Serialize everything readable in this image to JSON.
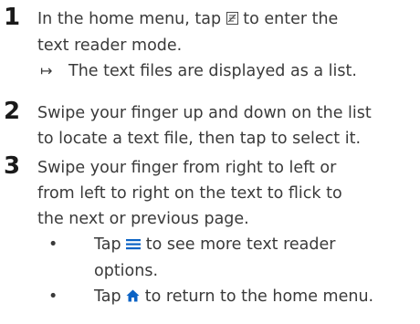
{
  "steps": [
    {
      "number": "1",
      "text_before_icon": "In the home menu, tap ",
      "icon": "text-reader-icon",
      "text_after_icon": " to enter the",
      "line2": "text reader mode.",
      "result": "The text files are displayed as a list."
    },
    {
      "number": "2",
      "line1": "Swipe your finger up and down on the list",
      "line2": "to locate a text file, then tap to select it."
    },
    {
      "number": "3",
      "line1": "Swipe your finger from right to left or",
      "line2": "from left to right on the text to flick to",
      "line3": "the next or previous page.",
      "bullets": [
        {
          "before": "Tap ",
          "icon": "menu-icon",
          "after": " to see more text reader",
          "cont": "options."
        },
        {
          "before": "Tap ",
          "icon": "home-icon",
          "after": " to return to the home menu."
        }
      ]
    }
  ],
  "colors": {
    "text": "#3a3a3a",
    "number": "#1a1a1a",
    "accent": "#0b63c5"
  }
}
